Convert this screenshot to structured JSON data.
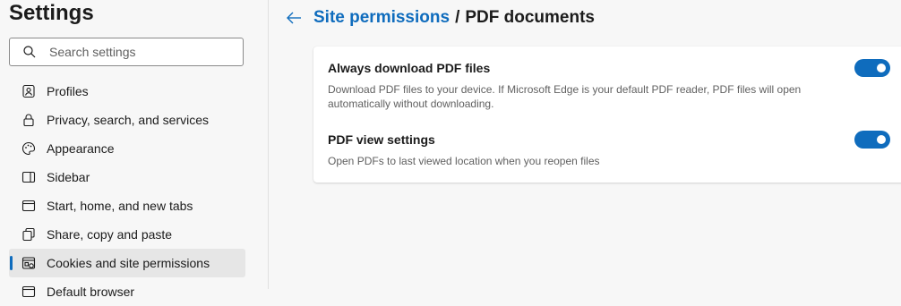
{
  "sidebar": {
    "title": "Settings",
    "search_placeholder": "Search settings",
    "items": [
      {
        "label": "Profiles",
        "icon": "profile-icon"
      },
      {
        "label": "Privacy, search, and services",
        "icon": "lock-icon"
      },
      {
        "label": "Appearance",
        "icon": "palette-icon"
      },
      {
        "label": "Sidebar",
        "icon": "sidebar-icon"
      },
      {
        "label": "Start, home, and new tabs",
        "icon": "home-tabs-icon"
      },
      {
        "label": "Share, copy and paste",
        "icon": "share-icon"
      },
      {
        "label": "Cookies and site permissions",
        "icon": "cookies-icon",
        "active": true
      },
      {
        "label": "Default browser",
        "icon": "browser-icon"
      }
    ]
  },
  "header": {
    "parent": "Site permissions",
    "separator": "/",
    "current": "PDF documents"
  },
  "settings": [
    {
      "title": "Always download PDF files",
      "description": "Download PDF files to your device. If Microsoft Edge is your default PDF reader, PDF files will open automatically without downloading.",
      "enabled": true
    },
    {
      "title": "PDF view settings",
      "description": "Open PDFs to last viewed location when you reopen files",
      "enabled": true
    }
  ],
  "colors": {
    "accent": "#0f6cbd",
    "background": "#f7f7f7",
    "card": "#ffffff"
  }
}
